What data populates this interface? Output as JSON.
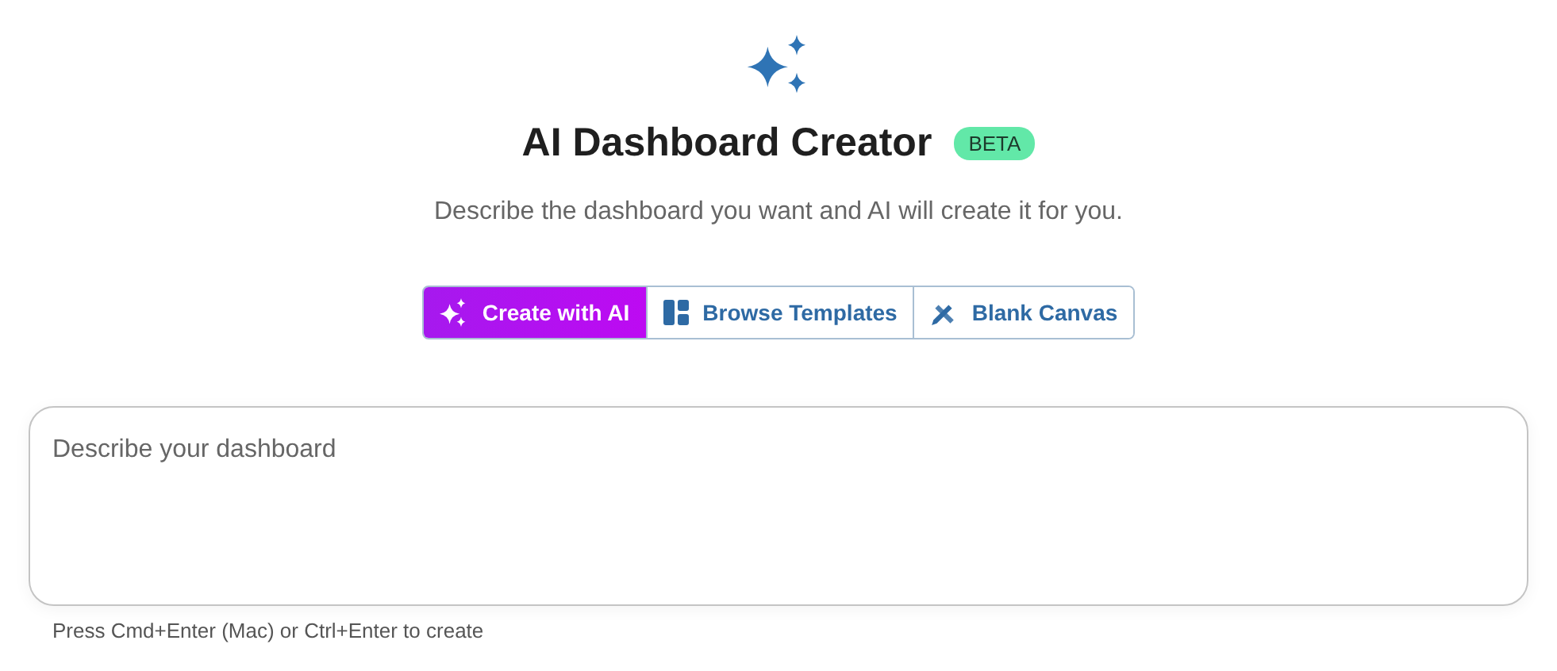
{
  "title": "AI Dashboard Creator",
  "badge": "BETA",
  "subtitle": "Describe the dashboard you want and AI will create it for you.",
  "tabs": [
    {
      "label": "Create with AI",
      "kind": "sparkle",
      "selected": true
    },
    {
      "label": "Browse Templates",
      "kind": "layout",
      "selected": false
    },
    {
      "label": "Blank Canvas",
      "kind": "tools",
      "selected": false
    }
  ],
  "prompt": {
    "placeholder": "Describe your dashboard"
  },
  "hint": "Press Cmd+Enter (Mac) or Ctrl+Enter to create"
}
